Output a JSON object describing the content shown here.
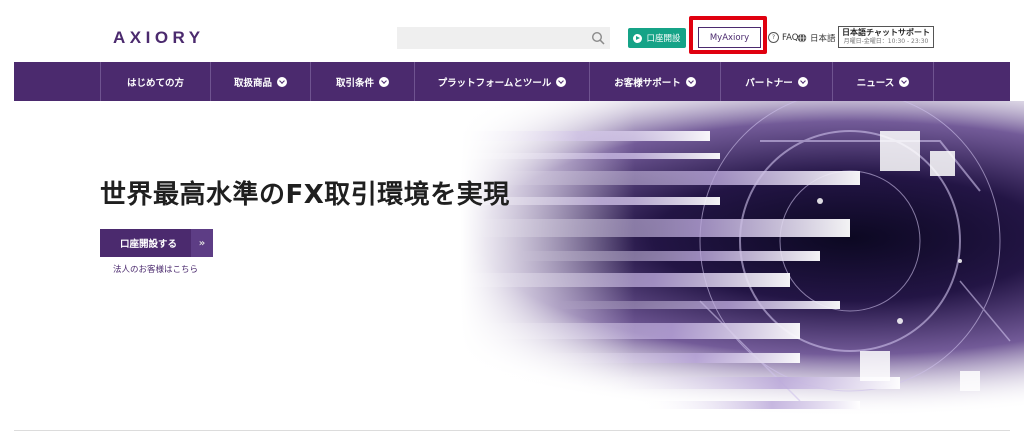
{
  "header": {
    "logo": "AXIORY",
    "search": {
      "placeholder": "",
      "icon": "search-icon"
    },
    "open_account_label": "口座開設",
    "myaxiory_label": "MyAxiory",
    "faq_label": "FAQ",
    "language_label": "日本語",
    "chat_support": {
      "title": "日本語チャットサポート",
      "hours": "月曜日-金曜日：10:30 - 23:30"
    }
  },
  "nav": {
    "items": [
      {
        "label": "はじめての方",
        "has_dropdown": false
      },
      {
        "label": "取扱商品",
        "has_dropdown": true
      },
      {
        "label": "取引条件",
        "has_dropdown": true
      },
      {
        "label": "プラットフォームとツール",
        "has_dropdown": true
      },
      {
        "label": "お客様サポート",
        "has_dropdown": true
      },
      {
        "label": "パートナー",
        "has_dropdown": true
      },
      {
        "label": "ニュース",
        "has_dropdown": true
      }
    ]
  },
  "hero": {
    "heading": "世界最高水準のFX取引環境を実現",
    "cta_label": "口座開設する",
    "cta_arrow": "»",
    "corporate_link": "法人のお客様はこちら"
  },
  "colors": {
    "brand_purple": "#4b2a6e",
    "accent_green": "#15a387",
    "highlight_red": "#e0000f"
  }
}
